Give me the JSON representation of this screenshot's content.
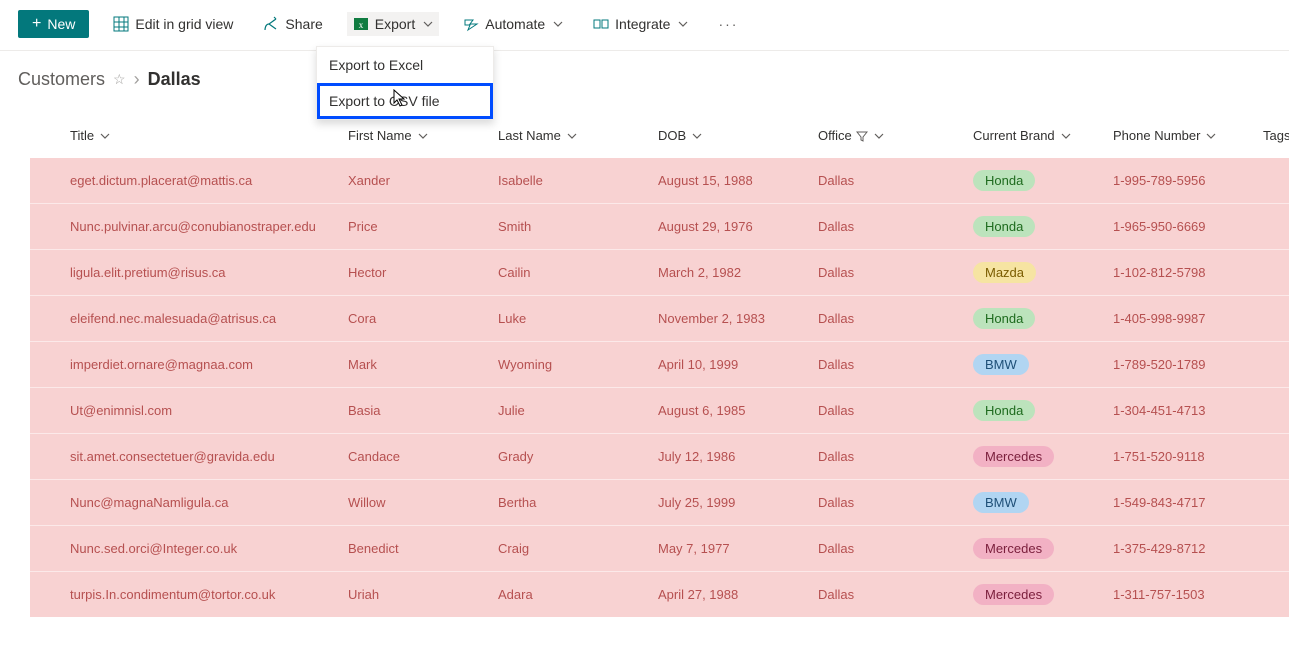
{
  "toolbar": {
    "new_label": "New",
    "edit_grid_label": "Edit in grid view",
    "share_label": "Share",
    "export_label": "Export",
    "automate_label": "Automate",
    "integrate_label": "Integrate",
    "export_menu": {
      "to_excel": "Export to Excel",
      "to_csv": "Export to CSV file"
    }
  },
  "breadcrumb": {
    "root": "Customers",
    "current": "Dallas"
  },
  "columns": {
    "title": "Title",
    "first_name": "First Name",
    "last_name": "Last Name",
    "dob": "DOB",
    "office": "Office",
    "current_brand": "Current Brand",
    "phone_number": "Phone Number",
    "tags": "Tags"
  },
  "brand_colors": {
    "Honda": "honda",
    "Mazda": "mazda",
    "BMW": "bmw",
    "Mercedes": "mercedes"
  },
  "rows": [
    {
      "title": "eget.dictum.placerat@mattis.ca",
      "first_name": "Xander",
      "last_name": "Isabelle",
      "dob": "August 15, 1988",
      "office": "Dallas",
      "brand": "Honda",
      "phone": "1-995-789-5956"
    },
    {
      "title": "Nunc.pulvinar.arcu@conubianostraper.edu",
      "first_name": "Price",
      "last_name": "Smith",
      "dob": "August 29, 1976",
      "office": "Dallas",
      "brand": "Honda",
      "phone": "1-965-950-6669"
    },
    {
      "title": "ligula.elit.pretium@risus.ca",
      "first_name": "Hector",
      "last_name": "Cailin",
      "dob": "March 2, 1982",
      "office": "Dallas",
      "brand": "Mazda",
      "phone": "1-102-812-5798"
    },
    {
      "title": "eleifend.nec.malesuada@atrisus.ca",
      "first_name": "Cora",
      "last_name": "Luke",
      "dob": "November 2, 1983",
      "office": "Dallas",
      "brand": "Honda",
      "phone": "1-405-998-9987"
    },
    {
      "title": "imperdiet.ornare@magnaa.com",
      "first_name": "Mark",
      "last_name": "Wyoming",
      "dob": "April 10, 1999",
      "office": "Dallas",
      "brand": "BMW",
      "phone": "1-789-520-1789"
    },
    {
      "title": "Ut@enimnisl.com",
      "first_name": "Basia",
      "last_name": "Julie",
      "dob": "August 6, 1985",
      "office": "Dallas",
      "brand": "Honda",
      "phone": "1-304-451-4713"
    },
    {
      "title": "sit.amet.consectetuer@gravida.edu",
      "first_name": "Candace",
      "last_name": "Grady",
      "dob": "July 12, 1986",
      "office": "Dallas",
      "brand": "Mercedes",
      "phone": "1-751-520-9118"
    },
    {
      "title": "Nunc@magnaNamligula.ca",
      "first_name": "Willow",
      "last_name": "Bertha",
      "dob": "July 25, 1999",
      "office": "Dallas",
      "brand": "BMW",
      "phone": "1-549-843-4717"
    },
    {
      "title": "Nunc.sed.orci@Integer.co.uk",
      "first_name": "Benedict",
      "last_name": "Craig",
      "dob": "May 7, 1977",
      "office": "Dallas",
      "brand": "Mercedes",
      "phone": "1-375-429-8712"
    },
    {
      "title": "turpis.In.condimentum@tortor.co.uk",
      "first_name": "Uriah",
      "last_name": "Adara",
      "dob": "April 27, 1988",
      "office": "Dallas",
      "brand": "Mercedes",
      "phone": "1-311-757-1503"
    }
  ]
}
